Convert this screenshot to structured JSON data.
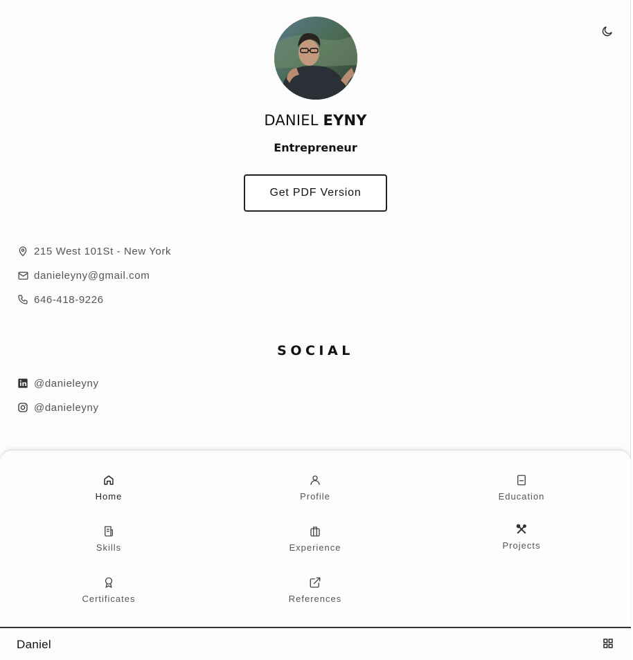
{
  "profile": {
    "first_name": "DANIEL",
    "last_name": "EYNY",
    "title": "Entrepreneur",
    "pdf_button": "Get PDF Version"
  },
  "contact": [
    {
      "icon": "location-pin-icon",
      "text": "215 West 101St - New York"
    },
    {
      "icon": "mail-icon",
      "text": "danieleyny@gmail.com"
    },
    {
      "icon": "phone-icon",
      "text": "646-418-9226"
    }
  ],
  "social": {
    "heading": "SOCIAL",
    "items": [
      {
        "icon": "linkedin-icon",
        "text": "@danieleyny"
      },
      {
        "icon": "instagram-icon",
        "text": "@danieleyny"
      }
    ]
  },
  "nav": {
    "items": [
      {
        "icon": "home-icon",
        "label": "Home",
        "active": true
      },
      {
        "icon": "user-icon",
        "label": "Profile"
      },
      {
        "icon": "book-icon",
        "label": "Education"
      },
      {
        "icon": "receipt-icon",
        "label": "Skills"
      },
      {
        "icon": "briefcase-icon",
        "label": "Experience"
      },
      {
        "icon": "tools-icon",
        "label": "Projects"
      },
      {
        "icon": "award-icon",
        "label": "Certificates"
      },
      {
        "icon": "external-link-icon",
        "label": "References"
      }
    ]
  },
  "footer": {
    "brand": "Daniel"
  },
  "colors": {
    "background": "#fcfcfc",
    "text": "#111111",
    "muted": "#555555",
    "border": "#222222"
  }
}
